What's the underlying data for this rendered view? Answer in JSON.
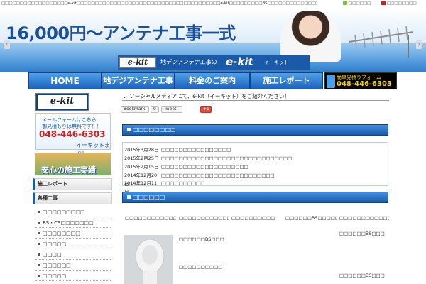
{
  "topbar": {
    "description": "□□□□□□□□□□□□□□□□□□e-kit□□□□□□□□□□□□□□□□□□□□□□□□□□□□□□□□□□□□□□□e-kit□□□□□□□□□BS□□□□□□□□□□□□□□□□□□□□□□□□□□□□□□□□□□",
    "link1": "□□□□□□",
    "link2": "□□□□□□□□"
  },
  "hero": {
    "price_text": "16,000円〜アンテナ工事一式",
    "prev_arrow": "‹",
    "next_arrow": "›"
  },
  "logo": {
    "box_text": "e-kit",
    "tagline": "地デジアンテナ工事の",
    "brand": "e-kit",
    "reading": "イーキット"
  },
  "nav": {
    "items": [
      "HOME",
      "地デジアンテナ工事",
      "料金のご案内",
      "施工レポート"
    ],
    "phone_line1": "簡単見積りフォーム",
    "phone_line2": "048-446-6303"
  },
  "sidebar": {
    "logo_text": "e-kit",
    "form_line1": "メールフォームはこちら",
    "form_line2": "御見積もりは無料です！！",
    "form_phone": "048-446-6303",
    "form_line3": "イーキットまで！",
    "build_text": "安心の施工実績",
    "head_report": "施工レポート",
    "head_works": "各種工事",
    "items": [
      "□□□□□□□□□",
      "BS・CS□□□□□□□",
      "□□□□□□□□",
      "□□□□□",
      "□□□□",
      "□□□□□□",
      "□□□□□"
    ]
  },
  "main": {
    "social_text": "ソーシャルメディアにて、e-kit（イーキット）をご紹介ください！",
    "social_buttons": [
      "Bookmark",
      "0",
      "Tweet",
      "+1"
    ],
    "news_head": "□□□□□□□□",
    "news": [
      {
        "date": "2015年3月28日",
        "title": "□□□□□□□□□□□□□□□□"
      },
      {
        "date": "2015年2月25日",
        "title": "□□□□□□□□□□□□□□□□□□□□□□□□□□□□□□"
      },
      {
        "date": "2015年2月15日",
        "title": "□□□□□□□□□□□□□□□□□□□□"
      },
      {
        "date": "2014年12月20日",
        "title": "□□□□□□□□□□□□□□□□□□□□□□□□□□"
      },
      {
        "date": "2014年12月11日",
        "title": "□□□□□□□□□□"
      }
    ],
    "report_head": "□□□□□□",
    "cards": [
      "□□□□□□□□□□□□□□□□",
      "□□□□□□□□□□□□□□□□□□□□",
      "□□□□□□□□□□",
      "□□□□□□BS□□□□□□□",
      "□□□□□□□□□□□□□□□□",
      "□□□□□□BS□□□",
      "□□□□□□□□□□",
      "□□□□□□BS□□□",
      "□□□□□□BS□□□"
    ]
  },
  "colors": {
    "brand_blue": "#1a5aa8",
    "phone_red": "#d51e1e",
    "phone_yellow": "#f3d400"
  }
}
